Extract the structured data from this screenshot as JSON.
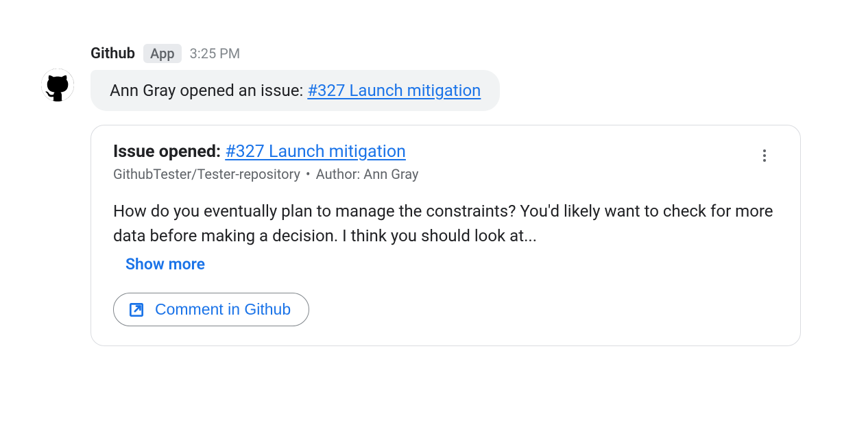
{
  "message": {
    "sender": "Github",
    "badge": "App",
    "timestamp": "3:25 PM",
    "summary_prefix": "Ann Gray opened an issue: ",
    "summary_link": "#327 Launch mitigation"
  },
  "issue": {
    "title_prefix": "Issue opened: ",
    "title_link": "#327 Launch mitigation",
    "repo": "GithubTester/Tester-repository",
    "author_label": "Author: Ann Gray",
    "body": "How do you eventually plan to manage the constraints? You'd likely want to check for more data before making a decision. I think you should look at...",
    "show_more": "Show more",
    "action_label": "Comment in Github"
  }
}
